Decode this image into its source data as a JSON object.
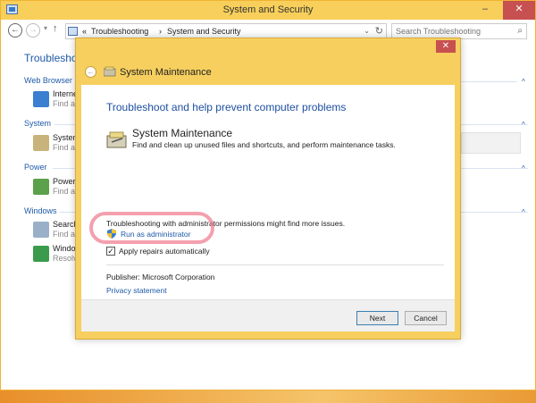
{
  "window": {
    "title": "System and Security",
    "minimize": "–",
    "maximize": "□",
    "close": "✕"
  },
  "navbar": {
    "back": "←",
    "forward": "→",
    "dropdown": "▾",
    "up": "↑",
    "breadcrumb_prefix": "«",
    "breadcrumb": [
      "Troubleshooting",
      "System and Security"
    ],
    "breadcrumb_sep": "›",
    "chevron": "⌄",
    "refresh": "↻",
    "search_placeholder": "Search Troubleshooting",
    "search_icon": "⌕"
  },
  "background": {
    "title": "Troublesho",
    "groups": [
      {
        "label": "Web Browser",
        "items": [
          {
            "t1": "Interne",
            "t2": "Find ar"
          }
        ]
      },
      {
        "label": "System",
        "items": [
          {
            "t1": "System",
            "t2": "Find ar"
          }
        ]
      },
      {
        "label": "Power",
        "items": [
          {
            "t1": "Power",
            "t2": "Find ar"
          }
        ]
      },
      {
        "label": "Windows",
        "items": [
          {
            "t1": "Search",
            "t2": "Find ar"
          },
          {
            "t1": "Windo",
            "t2": "Resolve"
          }
        ]
      }
    ],
    "caret": "^"
  },
  "dialog": {
    "close": "✕",
    "back": "←",
    "title": "System Maintenance",
    "heading": "Troubleshoot and help prevent computer problems",
    "tool_name": "System Maintenance",
    "tool_desc": "Find and clean up unused files and shortcuts, and perform maintenance tasks.",
    "admin_note": "Troubleshooting with administrator permissions might find more issues.",
    "run_admin": "Run as administrator",
    "apply_check": "✓",
    "apply_label": "Apply repairs automatically",
    "publisher": "Publisher:  Microsoft Corporation",
    "privacy": "Privacy statement",
    "next": "Next",
    "cancel": "Cancel"
  }
}
